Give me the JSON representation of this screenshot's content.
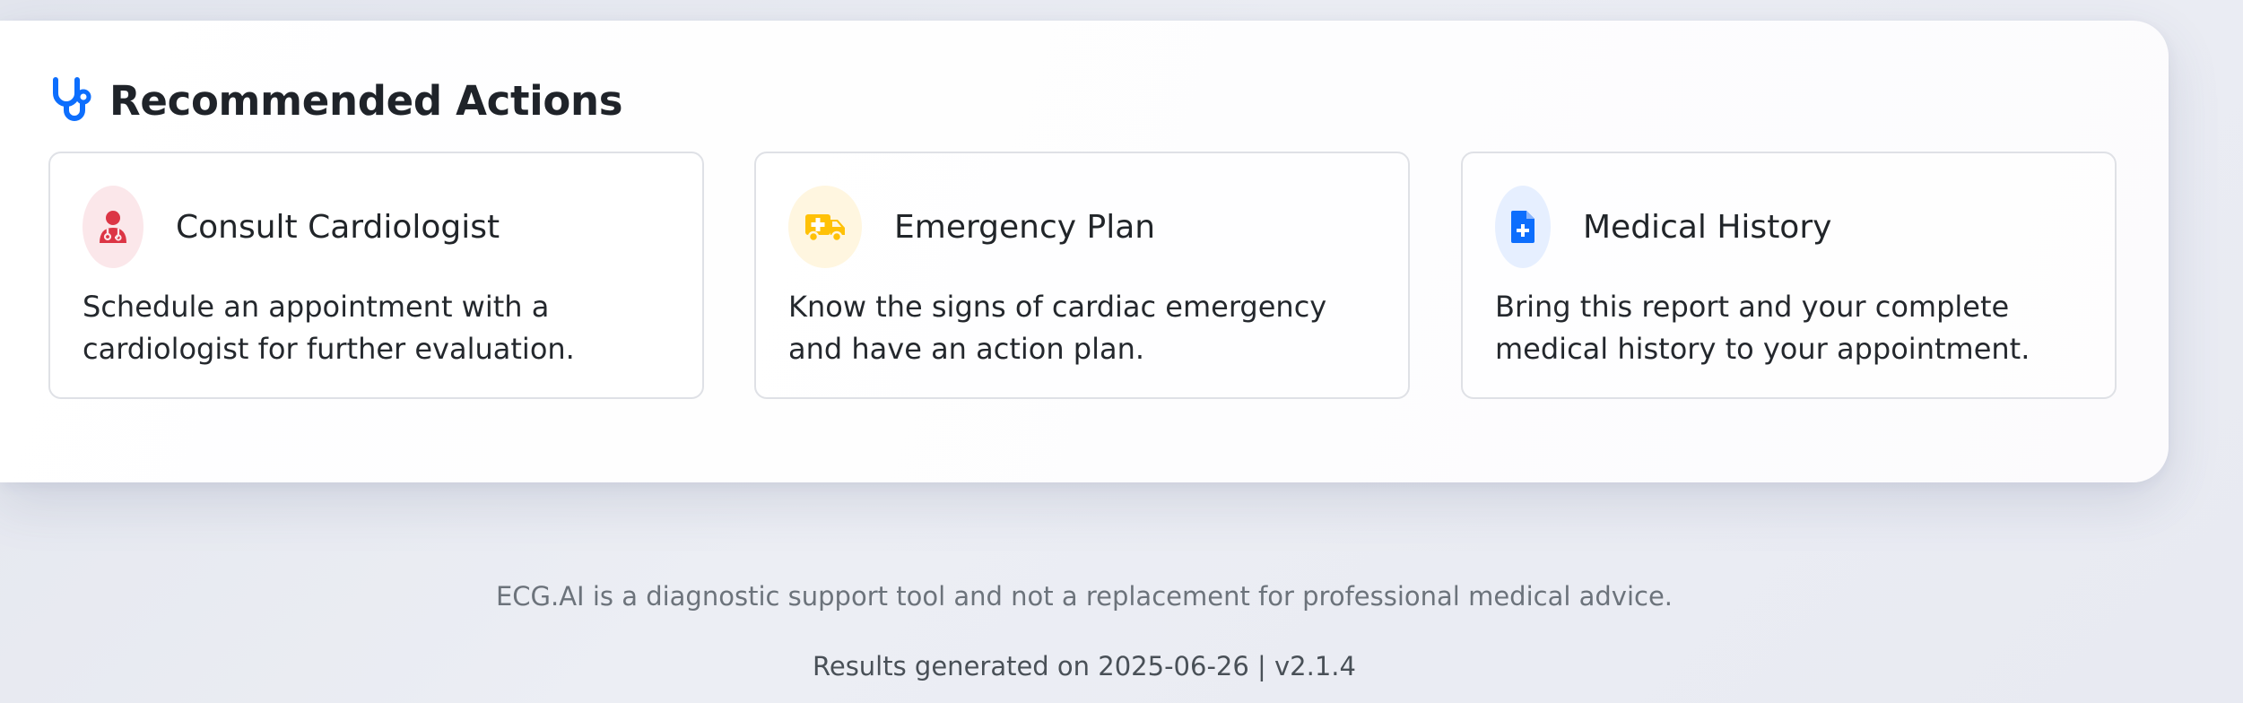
{
  "section": {
    "title": "Recommended Actions",
    "icon": "stethoscope-icon"
  },
  "colors": {
    "accent_blue": "#0d6efd",
    "danger_red": "#dc3545",
    "warning_yellow": "#ffc107"
  },
  "actions": [
    {
      "title": "Consult Cardiologist",
      "description": "Schedule an appointment with a cardiologist for further evaluation.",
      "icon": "doctor-icon",
      "icon_color": "#dc3545",
      "icon_bg": "#fbe7ea"
    },
    {
      "title": "Emergency Plan",
      "description": "Know the signs of cardiac emergency and have an action plan.",
      "icon": "ambulance-icon",
      "icon_color": "#ffc107",
      "icon_bg": "#fff6e0"
    },
    {
      "title": "Medical History",
      "description": "Bring this report and your complete medical history to your appointment.",
      "icon": "medical-file-icon",
      "icon_color": "#0d6efd",
      "icon_bg": "#e6efff"
    }
  ],
  "footer": {
    "disclaimer": "ECG.AI is a diagnostic support tool and not a replacement for professional medical advice.",
    "generated": "Results generated on 2025-06-26 | v2.1.4"
  }
}
